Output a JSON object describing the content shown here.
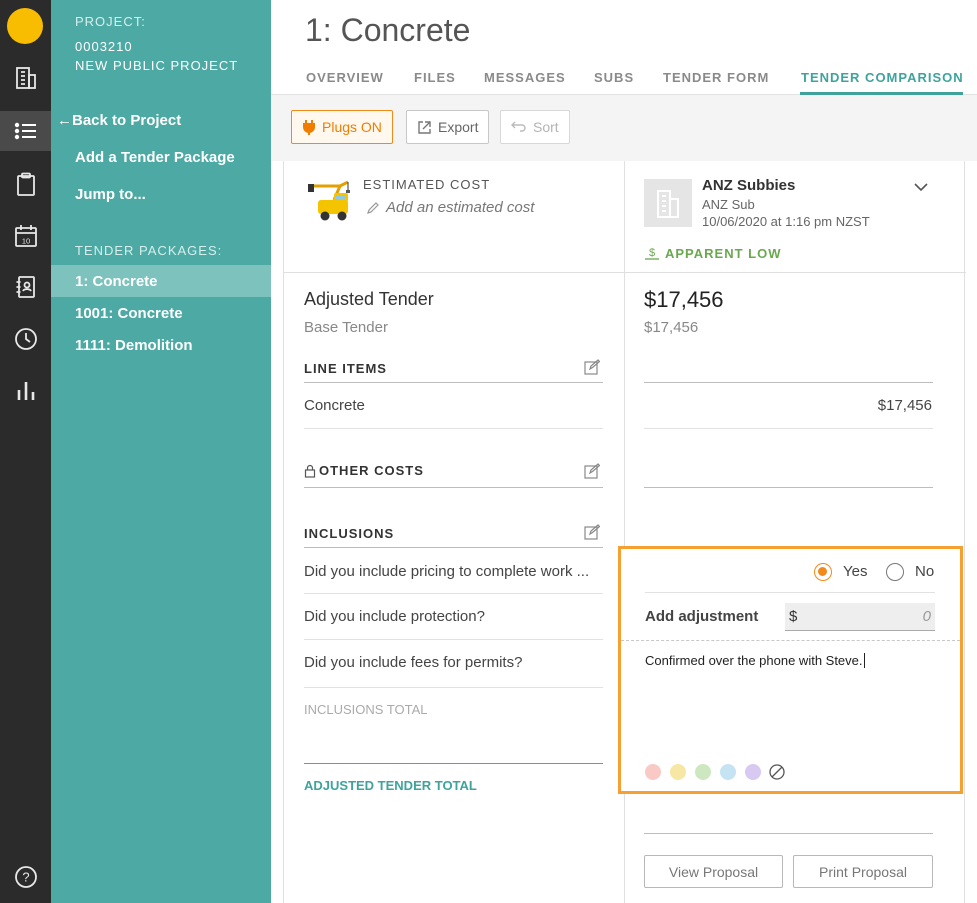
{
  "sidebar": {
    "project_caption": "PROJECT:",
    "project_number": "0003210",
    "project_name": "NEW PUBLIC PROJECT",
    "back_link": "Back to Project",
    "add_package": "Add a Tender Package",
    "jump_to": "Jump to...",
    "packages_caption": "TENDER PACKAGES:",
    "packages": [
      {
        "label": "1: Concrete",
        "active": true
      },
      {
        "label": "1001: Concrete",
        "active": false
      },
      {
        "label": "1111: Demolition",
        "active": false
      }
    ]
  },
  "rail": {
    "icons": [
      "building-icon",
      "list-icon",
      "clipboard-icon",
      "calendar-icon",
      "contacts-book-icon",
      "clock-icon",
      "bar-chart-icon",
      "help-icon"
    ],
    "calendar_day": "10",
    "help_glyph": "?"
  },
  "page": {
    "title": "1: Concrete",
    "tabs": [
      "OVERVIEW",
      "FILES",
      "MESSAGES",
      "SUBS",
      "TENDER FORM",
      "TENDER COMPARISON"
    ],
    "active_tab": "TENDER COMPARISON"
  },
  "toolbar": {
    "plugs_label": "Plugs ON",
    "export_label": "Export",
    "sort_label": "Sort"
  },
  "estimate": {
    "caption": "ESTIMATED COST",
    "placeholder": "Add an estimated cost"
  },
  "bidder": {
    "company": "ANZ Subbies",
    "trade": "ANZ Sub",
    "timestamp": "10/06/2020 at 1:16 pm NZST",
    "badge": "APPARENT LOW",
    "adjusted_tender": "$17,456",
    "base_tender": "$17,456",
    "line_items": [
      {
        "value": "$17,456"
      }
    ],
    "include_pricing": "Yes",
    "radio_yes": "Yes",
    "radio_no": "No",
    "adjustment_label": "Add adjustment",
    "adjustment_currency": "$",
    "adjustment_value": "0",
    "note": "Confirmed over the phone with Steve.",
    "note_colors": [
      "#f9c9c6",
      "#f7e7a4",
      "#cde8c1",
      "#c5e3f2",
      "#d8c9f2"
    ],
    "view_proposal": "View Proposal",
    "print_proposal": "Print Proposal"
  },
  "labels": {
    "adjusted_tender": "Adjusted Tender",
    "base_tender": "Base Tender",
    "line_items": "LINE ITEMS",
    "line_item_rows": [
      "Concrete"
    ],
    "other_costs": "OTHER COSTS",
    "inclusions": "INCLUSIONS",
    "inclusion_rows": [
      "Did you include pricing to complete work ...",
      "Did you include protection?",
      "Did you include fees for permits?"
    ],
    "inclusions_total": "INCLUSIONS TOTAL",
    "adjusted_tender_total": "ADJUSTED TENDER TOTAL"
  },
  "colors": {
    "teal": "#4da9a3",
    "accent_orange": "#f28a1a",
    "apparent_low_green": "#6aa84f"
  }
}
